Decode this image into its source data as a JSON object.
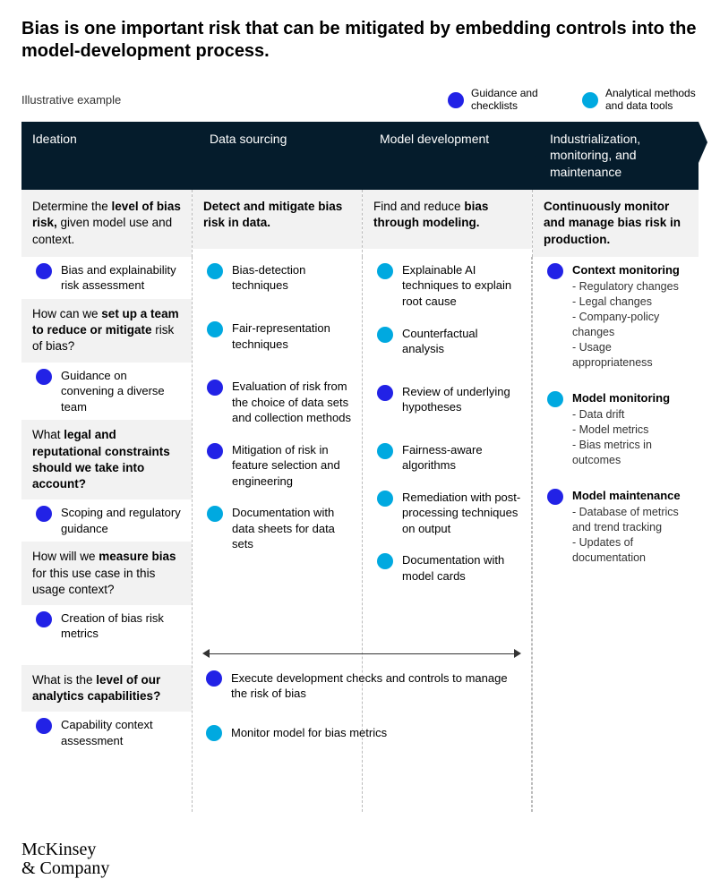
{
  "title": "Bias is one important risk that can be mitigated by embedding controls into the model-development process.",
  "illustrative": "Illustrative example",
  "legend": {
    "guidance": "Guidance and checklists",
    "analytical": "Analytical methods and data tools"
  },
  "columns": {
    "c1": "Ideation",
    "c2": "Data sourcing",
    "c3": "Model development",
    "c4": "Industrialization, monitoring, and maintenance"
  },
  "leads": {
    "c1_a": "Determine the ",
    "c1_b": "level of bias risk,",
    "c1_c": " given model use and context.",
    "c2_a": "Detect and mitigate bias risk in data.",
    "c3_a": "Find and reduce ",
    "c3_b": "bias through modeling.",
    "c4_a": "Continuously monitor and manage bias risk in production."
  },
  "col1": {
    "i1": "Bias and explainability risk assessment",
    "q2_a": "How can we ",
    "q2_b": "set up a team to reduce or mitigate",
    "q2_c": " risk of bias?",
    "i2": "Guidance on convening a diverse team",
    "q3_a": "What ",
    "q3_b": "legal and reputational constraints should we take into account?",
    "i3": "Scoping and regulatory guid­ance",
    "q4_a": "How will we ",
    "q4_b": "measure bias",
    "q4_c": " for this use case in this usage context?",
    "i4": "Creation of bias risk metrics",
    "q5_a": "What is the ",
    "q5_b": "level of our analytics capabilities?",
    "i5": "Capability context assessment"
  },
  "col2": {
    "i1": "Bias-detection techniques",
    "i2": "Fair-representation techniques",
    "i3": "Evaluation of  risk from the choice of data sets and collection methods",
    "i4": "Mitigation of risk in feature selection and engineering",
    "i5": "Documentation with data sheets for data sets"
  },
  "col3": {
    "i1": "Explainable AI techniques to explain root cause",
    "i2": "Counterfactual analysis",
    "i3": "Review of underlying hypotheses",
    "i4": "Fairness-aware algorithms",
    "i5": "Remediation with post-processing techniques on output",
    "i6": "Documentation with model cards"
  },
  "col4": {
    "h1": "Context monitoring",
    "h1s1": "Regulatory changes",
    "h1s2": "Legal changes",
    "h1s3": "Company-policy changes",
    "h1s4": "Usage appropriateness",
    "h2": "Model monitoring",
    "h2s1": "Data drift",
    "h2s2": "Model metrics",
    "h2s3": "Bias metrics in outcomes",
    "h3": "Model maintenance",
    "h3s1": "Database of metrics and trend tracking",
    "h3s2": "Updates of documentation"
  },
  "spanned": {
    "s1": "Execute development checks and controls to manage the risk of bias",
    "s2": "Monitor model for bias metrics"
  },
  "footer1": "McKinsey",
  "footer2": "& Company"
}
